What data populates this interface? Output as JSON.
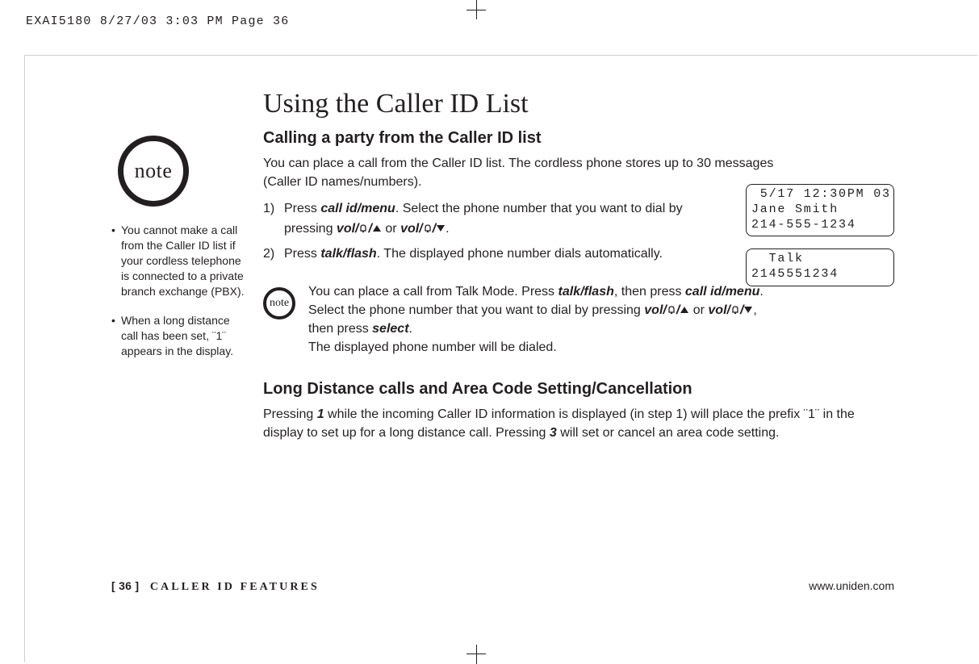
{
  "crop_header": "EXAI5180  8/27/03 3:03 PM  Page 36",
  "note_label": "note",
  "sidebar": {
    "items": [
      "You cannot make a call from the Caller ID list if your cordless telephone is connected to a private branch exchange (PBX).",
      "When a long distance call has been set, ¨1¨ appears in the display."
    ]
  },
  "title": "Using the Caller ID List",
  "section1": {
    "heading": "Calling a party from the Caller ID list",
    "lead": "You can place a call from the Caller ID list. The cordless phone stores up to 30 messages (Caller ID names/numbers).",
    "step1a": "Press ",
    "step1_kw1": "call id/menu",
    "step1b": ". Select the phone number that you want to dial by pressing ",
    "step1_kw2": "vol/",
    "step1c": " or ",
    "step1_kw3": "vol/",
    "step1d": ".",
    "step2a": "Press ",
    "step2_kw1": "talk/flash",
    "step2b": ". The displayed phone number dials automatically."
  },
  "lcd1": {
    "line1": " 5/17 12:30PM 03",
    "line2": "Jane Smith",
    "line3": "214-555-1234"
  },
  "lcd2": {
    "line1": "  Talk",
    "line2": "2145551234"
  },
  "inline_note": {
    "t1": "You can place a call from Talk Mode. Press ",
    "kw1": "talk/flash",
    "t2": ", then press ",
    "kw2": "call id/menu",
    "t3": ". Select the phone number that you want to dial by pressing ",
    "kw3": "vol/",
    "t4": " or ",
    "kw4": "vol/",
    "t5": ", then press ",
    "kw5": "select",
    "t6": ".",
    "t7": "The displayed phone number will be dialed."
  },
  "section2": {
    "heading": "Long Distance calls and Area Code Setting/Cancellation",
    "t1": "Pressing ",
    "kw1": "1",
    "t2": " while the incoming Caller ID information is displayed (in step 1) will place the prefix ¨1¨ in the display to set up for a long distance call. Pressing ",
    "kw2": "3",
    "t3": " will set or cancel an area code setting."
  },
  "footer": {
    "page": "[ 36 ]",
    "section": "CALLER ID FEATURES",
    "url": "www.uniden.com"
  }
}
